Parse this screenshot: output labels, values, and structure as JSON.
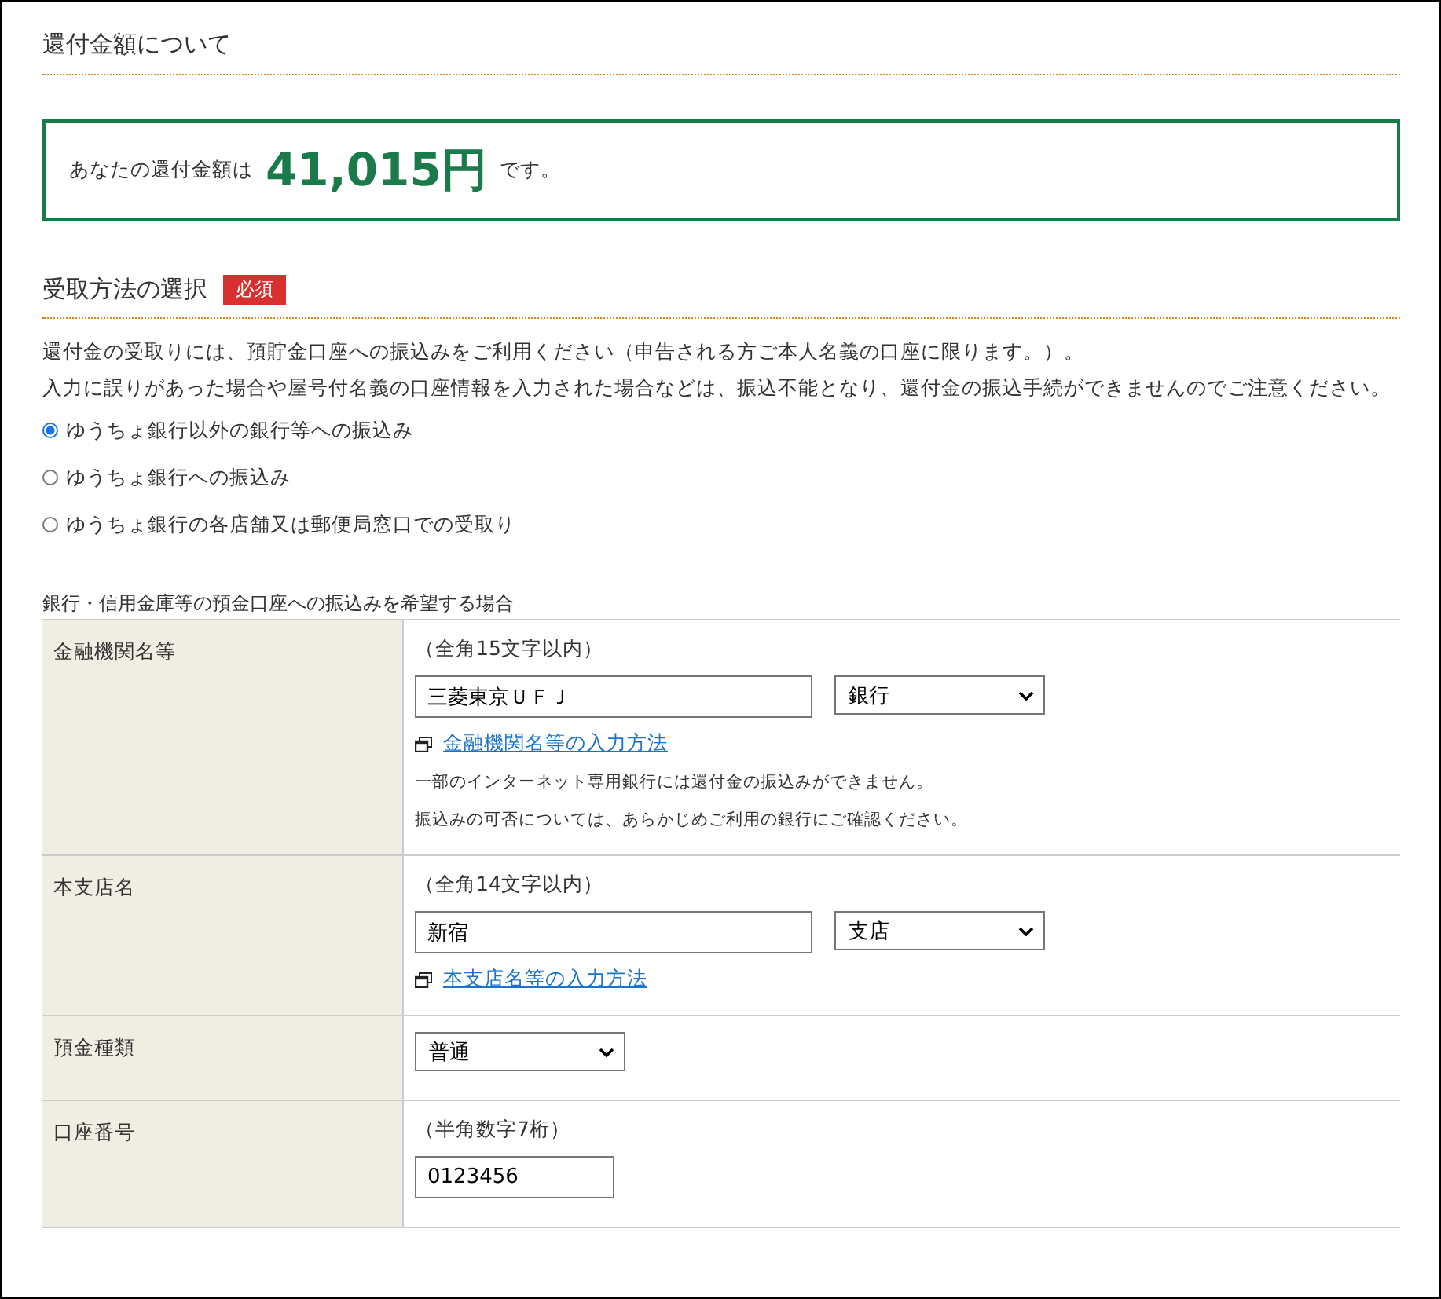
{
  "refund_section": {
    "title": "還付金額について",
    "prefix": "あなたの還付金額は",
    "amount": "41,015円",
    "suffix": "です。"
  },
  "method_section": {
    "title": "受取方法の選択",
    "badge": "必須",
    "notes": [
      "還付金の受取りには、預貯金口座への振込みをご利用ください（申告される方ご本人名義の口座に限ります。）。",
      "入力に誤りがあった場合や屋号付名義の口座情報を入力された場合などは、振込不能となり、還付金の振込手続ができませんのでご注意ください。"
    ],
    "options": [
      {
        "label": "ゆうちょ銀行以外の銀行等への振込み",
        "selected": true
      },
      {
        "label": "ゆうちょ銀行への振込み",
        "selected": false
      },
      {
        "label": "ゆうちょ銀行の各店舗又は郵便局窓口での受取り",
        "selected": false
      }
    ]
  },
  "bank_form": {
    "caption": "銀行・信用金庫等の預金口座への振込みを希望する場合",
    "rows": [
      {
        "label": "金融機関名等",
        "hint": "（全角15文字以内）",
        "fields": [
          {
            "kind": "input",
            "value": "三菱東京ＵＦＪ"
          },
          {
            "kind": "select",
            "value": "銀行"
          }
        ],
        "link": "金融機関名等の入力方法",
        "notes": [
          "一部のインターネット専用銀行には還付金の振込みができません。",
          "振込みの可否については、あらかじめご利用の銀行にご確認ください。"
        ]
      },
      {
        "label": "本支店名",
        "hint": "（全角14文字以内）",
        "fields": [
          {
            "kind": "input",
            "value": "新宿"
          },
          {
            "kind": "select",
            "value": "支店"
          }
        ],
        "link": "本支店名等の入力方法"
      },
      {
        "label": "預金種類",
        "fields": [
          {
            "kind": "select_short",
            "value": "普通"
          }
        ]
      },
      {
        "label": "口座番号",
        "hint": "（半角数字7桁）",
        "fields": [
          {
            "kind": "input_short",
            "value": "0123456"
          }
        ]
      }
    ]
  }
}
